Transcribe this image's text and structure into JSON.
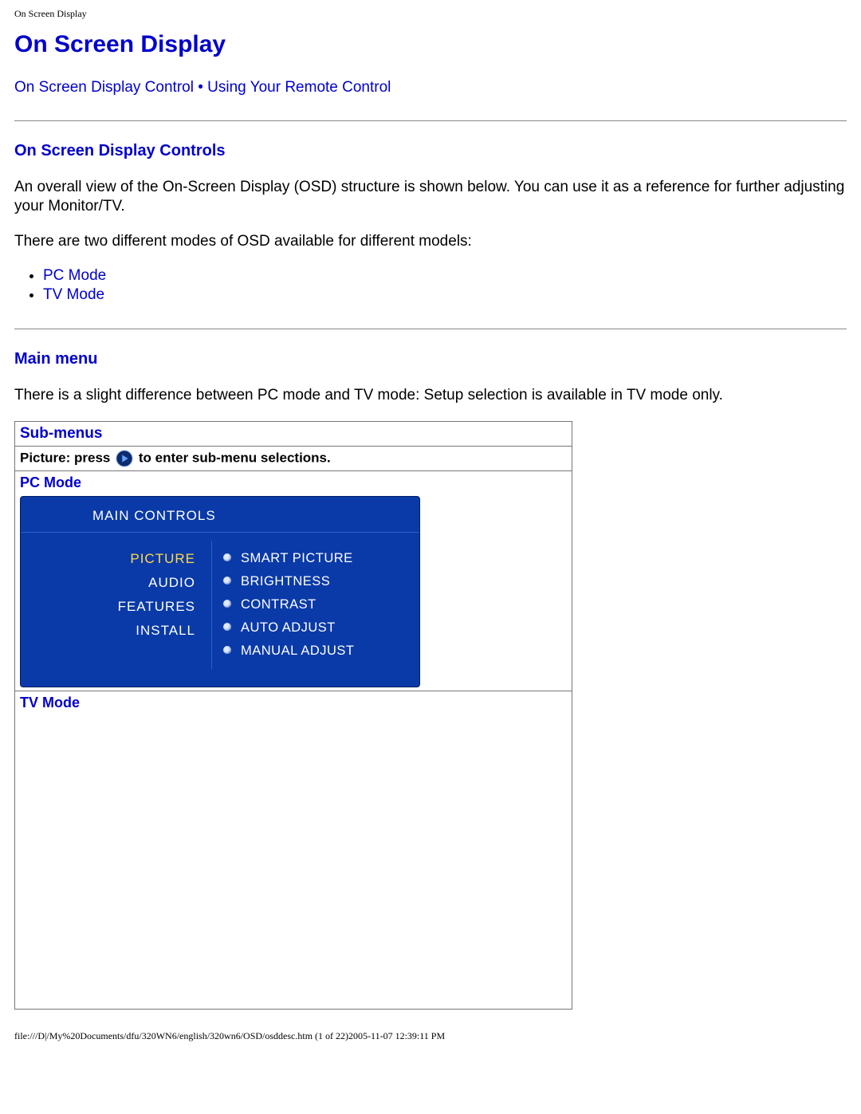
{
  "header_small": "On Screen Display",
  "title": "On Screen Display",
  "nav": {
    "link1": "On Screen Display Control",
    "sep": " • ",
    "link2": "Using Your Remote Control"
  },
  "section1": {
    "heading": "On Screen Display Controls",
    "para1": "An overall view of the On-Screen Display (OSD) structure is shown below.  You can use it as a reference for further adjusting your Monitor/TV.",
    "para2": "There are two different modes of OSD available for different models:",
    "modes": [
      "PC Mode",
      "TV Mode"
    ]
  },
  "section2": {
    "heading": "Main menu",
    "para": "There is a slight difference between PC mode and TV mode: Setup selection is available in TV mode only."
  },
  "table": {
    "submenus": "Sub-menus",
    "picture_prefix": "Picture: press",
    "picture_suffix": "to enter sub-menu selections.",
    "pc_mode_label": "PC Mode",
    "tv_mode_label": "TV Mode"
  },
  "osd": {
    "title": "MAIN  CONTROLS",
    "left": [
      "PICTURE",
      "AUDIO",
      "FEATURES",
      "INSTALL"
    ],
    "selected_index": 0,
    "right": [
      "SMART PICTURE",
      "BRIGHTNESS",
      "CONTRAST",
      "AUTO ADJUST",
      "MANUAL ADJUST"
    ]
  },
  "footer": "file:///D|/My%20Documents/dfu/320WN6/english/320wn6/OSD/osddesc.htm (1 of 22)2005-11-07 12:39:11 PM"
}
